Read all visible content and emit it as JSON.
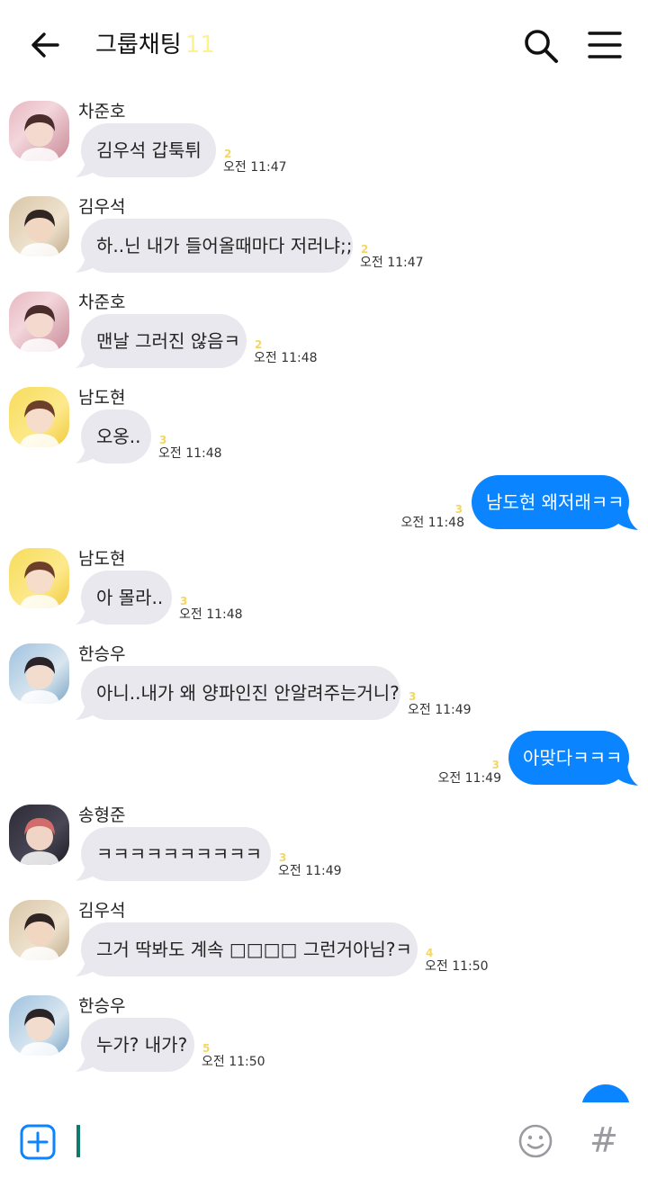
{
  "header": {
    "title": "그룹채팅",
    "member_count": "11"
  },
  "colors": {
    "accent": "#0a84ff",
    "incoming_bubble": "#e9e8ee",
    "unread": "#f2d766",
    "member_count": "#fff28a",
    "caret": "#0f7a6e"
  },
  "messages": [
    {
      "type": "in",
      "sender": "차준호",
      "text": "김우석 갑툭튀",
      "unread": "2",
      "time": "오전 11:47",
      "avatar": "pink"
    },
    {
      "type": "in",
      "sender": "김우석",
      "text": "하..닌 내가 들어올때마다 저러냐;;",
      "unread": "2",
      "time": "오전 11:47",
      "avatar": "beige"
    },
    {
      "type": "in",
      "sender": "차준호",
      "text": "맨날 그러진 않음ㅋ",
      "unread": "2",
      "time": "오전 11:48",
      "avatar": "pink"
    },
    {
      "type": "in",
      "sender": "남도현",
      "text": "오옹..",
      "unread": "3",
      "time": "오전 11:48",
      "avatar": "yellow"
    },
    {
      "type": "out",
      "text": "남도현 왜저래ㅋㅋ",
      "unread": "3",
      "time": "오전 11:48"
    },
    {
      "type": "in",
      "sender": "남도현",
      "text": "아 몰라..",
      "unread": "3",
      "time": "오전 11:48",
      "avatar": "yellow"
    },
    {
      "type": "in",
      "sender": "한승우",
      "text": "아니..내가 왜 양파인진 안알려주는거니?",
      "unread": "3",
      "time": "오전 11:49",
      "avatar": "blue"
    },
    {
      "type": "out",
      "text": "아맞다ㅋㅋㅋ",
      "unread": "3",
      "time": "오전 11:49"
    },
    {
      "type": "in",
      "sender": "송형준",
      "text": "ㅋㅋㅋㅋㅋㅋㅋㅋㅋㅋ",
      "unread": "3",
      "time": "오전 11:49",
      "avatar": "dark"
    },
    {
      "type": "in",
      "sender": "김우석",
      "text": "그거 딱봐도 계속 □□□□ 그런거아님?ㅋ",
      "unread": "4",
      "time": "오전 11:50",
      "avatar": "beige"
    },
    {
      "type": "in",
      "sender": "한승우",
      "text": "누가? 내가?",
      "unread": "5",
      "time": "오전 11:50",
      "avatar": "blue"
    }
  ],
  "input": {
    "value": ""
  },
  "icons": {
    "back": "arrow-left-icon",
    "search": "search-icon",
    "menu": "hamburger-menu-icon",
    "add": "plus-square-icon",
    "emoji": "smiley-icon",
    "hashtag": "#"
  }
}
